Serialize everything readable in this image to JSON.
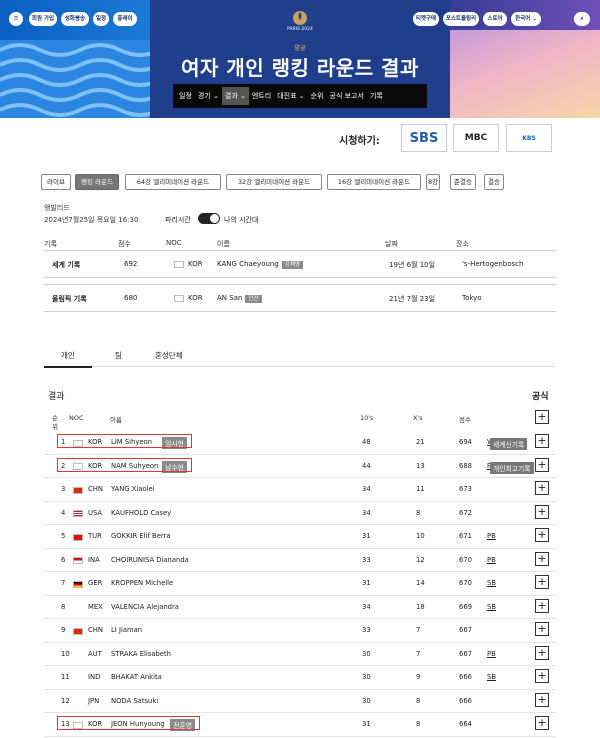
{
  "header": {
    "left_pills": [
      "☰",
      "회원 가입",
      "성화봉송",
      "일정",
      "홍레이"
    ],
    "right_pills": [
      "티켓구매",
      "포스트올림리",
      "스토어",
      "한국어 ⌄",
      "⌕"
    ],
    "logo_text": "PARIS 2024",
    "sport": "양궁",
    "title": "여자 개인 랭킹 라운드 결과",
    "nav": [
      "일정",
      "경기 ⌄",
      "결과 ⌄",
      "엔트리",
      "대진표 ⌄",
      "순위",
      "공식 보고서",
      "기록"
    ]
  },
  "broadcast": {
    "label": "시청하기:",
    "channels": [
      "SBS",
      "MBC",
      "KBS"
    ]
  },
  "filters": [
    "라이브",
    "랭킹 라운드",
    "64강 엘리미네이션 라운드",
    "32강 엘리미네이션 라운드",
    "16강 엘리미네이션 라운드",
    "8강",
    "준결승",
    "결승"
  ],
  "meta": {
    "venue": "앵발리드",
    "datetime": "2024년7월25일 목요일 16:30",
    "tz_left": "파리시간",
    "tz_right": "나의 시간대"
  },
  "records": {
    "headers": [
      "기록",
      "점수",
      "NOC",
      "이름",
      "날짜",
      "장소"
    ],
    "rows": [
      {
        "type": "세계 기록",
        "score": "692",
        "noc": "KOR",
        "name": "KANG Chaeyoung",
        "badge": "강채영",
        "date": "19년 6월 10일",
        "place": "'s-Hertogenbosch"
      },
      {
        "type": "올림픽 기록",
        "score": "680",
        "noc": "KOR",
        "name": "AN San",
        "badge": "안산",
        "date": "21년 7월 23일",
        "place": "Tokyo"
      }
    ]
  },
  "section_tabs": [
    "개인",
    "팀",
    "혼성단체"
  ],
  "results": {
    "title": "결과",
    "official": "공식",
    "headers": {
      "rank": "순위",
      "noc": "NOC",
      "name": "이름",
      "tens": "10's",
      "xs": "X's",
      "score": "점수"
    },
    "rows": [
      {
        "rank": "1",
        "noc": "KOR",
        "name": "LIM Sihyeon",
        "badge": "임시현",
        "tens": "48",
        "xs": "21",
        "score": "694",
        "rec": "WR",
        "tag": "세계신기록"
      },
      {
        "rank": "2",
        "noc": "KOR",
        "name": "NAM Suhyeon",
        "badge": "남수현",
        "tens": "44",
        "xs": "13",
        "score": "688",
        "rec": "PB",
        "tag": "개인최고기록"
      },
      {
        "rank": "3",
        "noc": "CHN",
        "name": "YANG Xiaolei",
        "badge": "",
        "tens": "34",
        "xs": "11",
        "score": "673",
        "rec": "",
        "tag": ""
      },
      {
        "rank": "4",
        "noc": "USA",
        "name": "KAUFHOLD Casey",
        "badge": "",
        "tens": "34",
        "xs": "8",
        "score": "672",
        "rec": "",
        "tag": ""
      },
      {
        "rank": "5",
        "noc": "TUR",
        "name": "GOKKIR Elif Berra",
        "badge": "",
        "tens": "31",
        "xs": "10",
        "score": "671",
        "rec": "PB",
        "tag": ""
      },
      {
        "rank": "6",
        "noc": "INA",
        "name": "CHOIRUNISA Diananda",
        "badge": "",
        "tens": "33",
        "xs": "12",
        "score": "670",
        "rec": "PB",
        "tag": ""
      },
      {
        "rank": "7",
        "noc": "GER",
        "name": "KROPPEN Michelle",
        "badge": "",
        "tens": "31",
        "xs": "14",
        "score": "670",
        "rec": "SB",
        "tag": ""
      },
      {
        "rank": "8",
        "noc": "MEX",
        "name": "VALENCIA Alejandra",
        "badge": "",
        "tens": "34",
        "xs": "18",
        "score": "669",
        "rec": "SB",
        "tag": ""
      },
      {
        "rank": "9",
        "noc": "CHN",
        "name": "LI Jiaman",
        "badge": "",
        "tens": "33",
        "xs": "7",
        "score": "667",
        "rec": "",
        "tag": ""
      },
      {
        "rank": "10",
        "noc": "AUT",
        "name": "STRAKA Elisabeth",
        "badge": "",
        "tens": "30",
        "xs": "7",
        "score": "667",
        "rec": "PB",
        "tag": ""
      },
      {
        "rank": "11",
        "noc": "IND",
        "name": "BHAKAT Ankita",
        "badge": "",
        "tens": "30",
        "xs": "9",
        "score": "666",
        "rec": "SB",
        "tag": ""
      },
      {
        "rank": "12",
        "noc": "JPN",
        "name": "NODA Satsuki",
        "badge": "",
        "tens": "30",
        "xs": "8",
        "score": "666",
        "rec": "",
        "tag": ""
      },
      {
        "rank": "13",
        "noc": "KOR",
        "name": "JEON Hunyoung",
        "badge": "전훈영",
        "tens": "31",
        "xs": "8",
        "score": "664",
        "rec": "",
        "tag": ""
      }
    ]
  },
  "colors": {
    "hero_blue": "#1f3e8c",
    "highlight_red": "#d23b3b",
    "badge_gray": "#8a8a8a"
  }
}
